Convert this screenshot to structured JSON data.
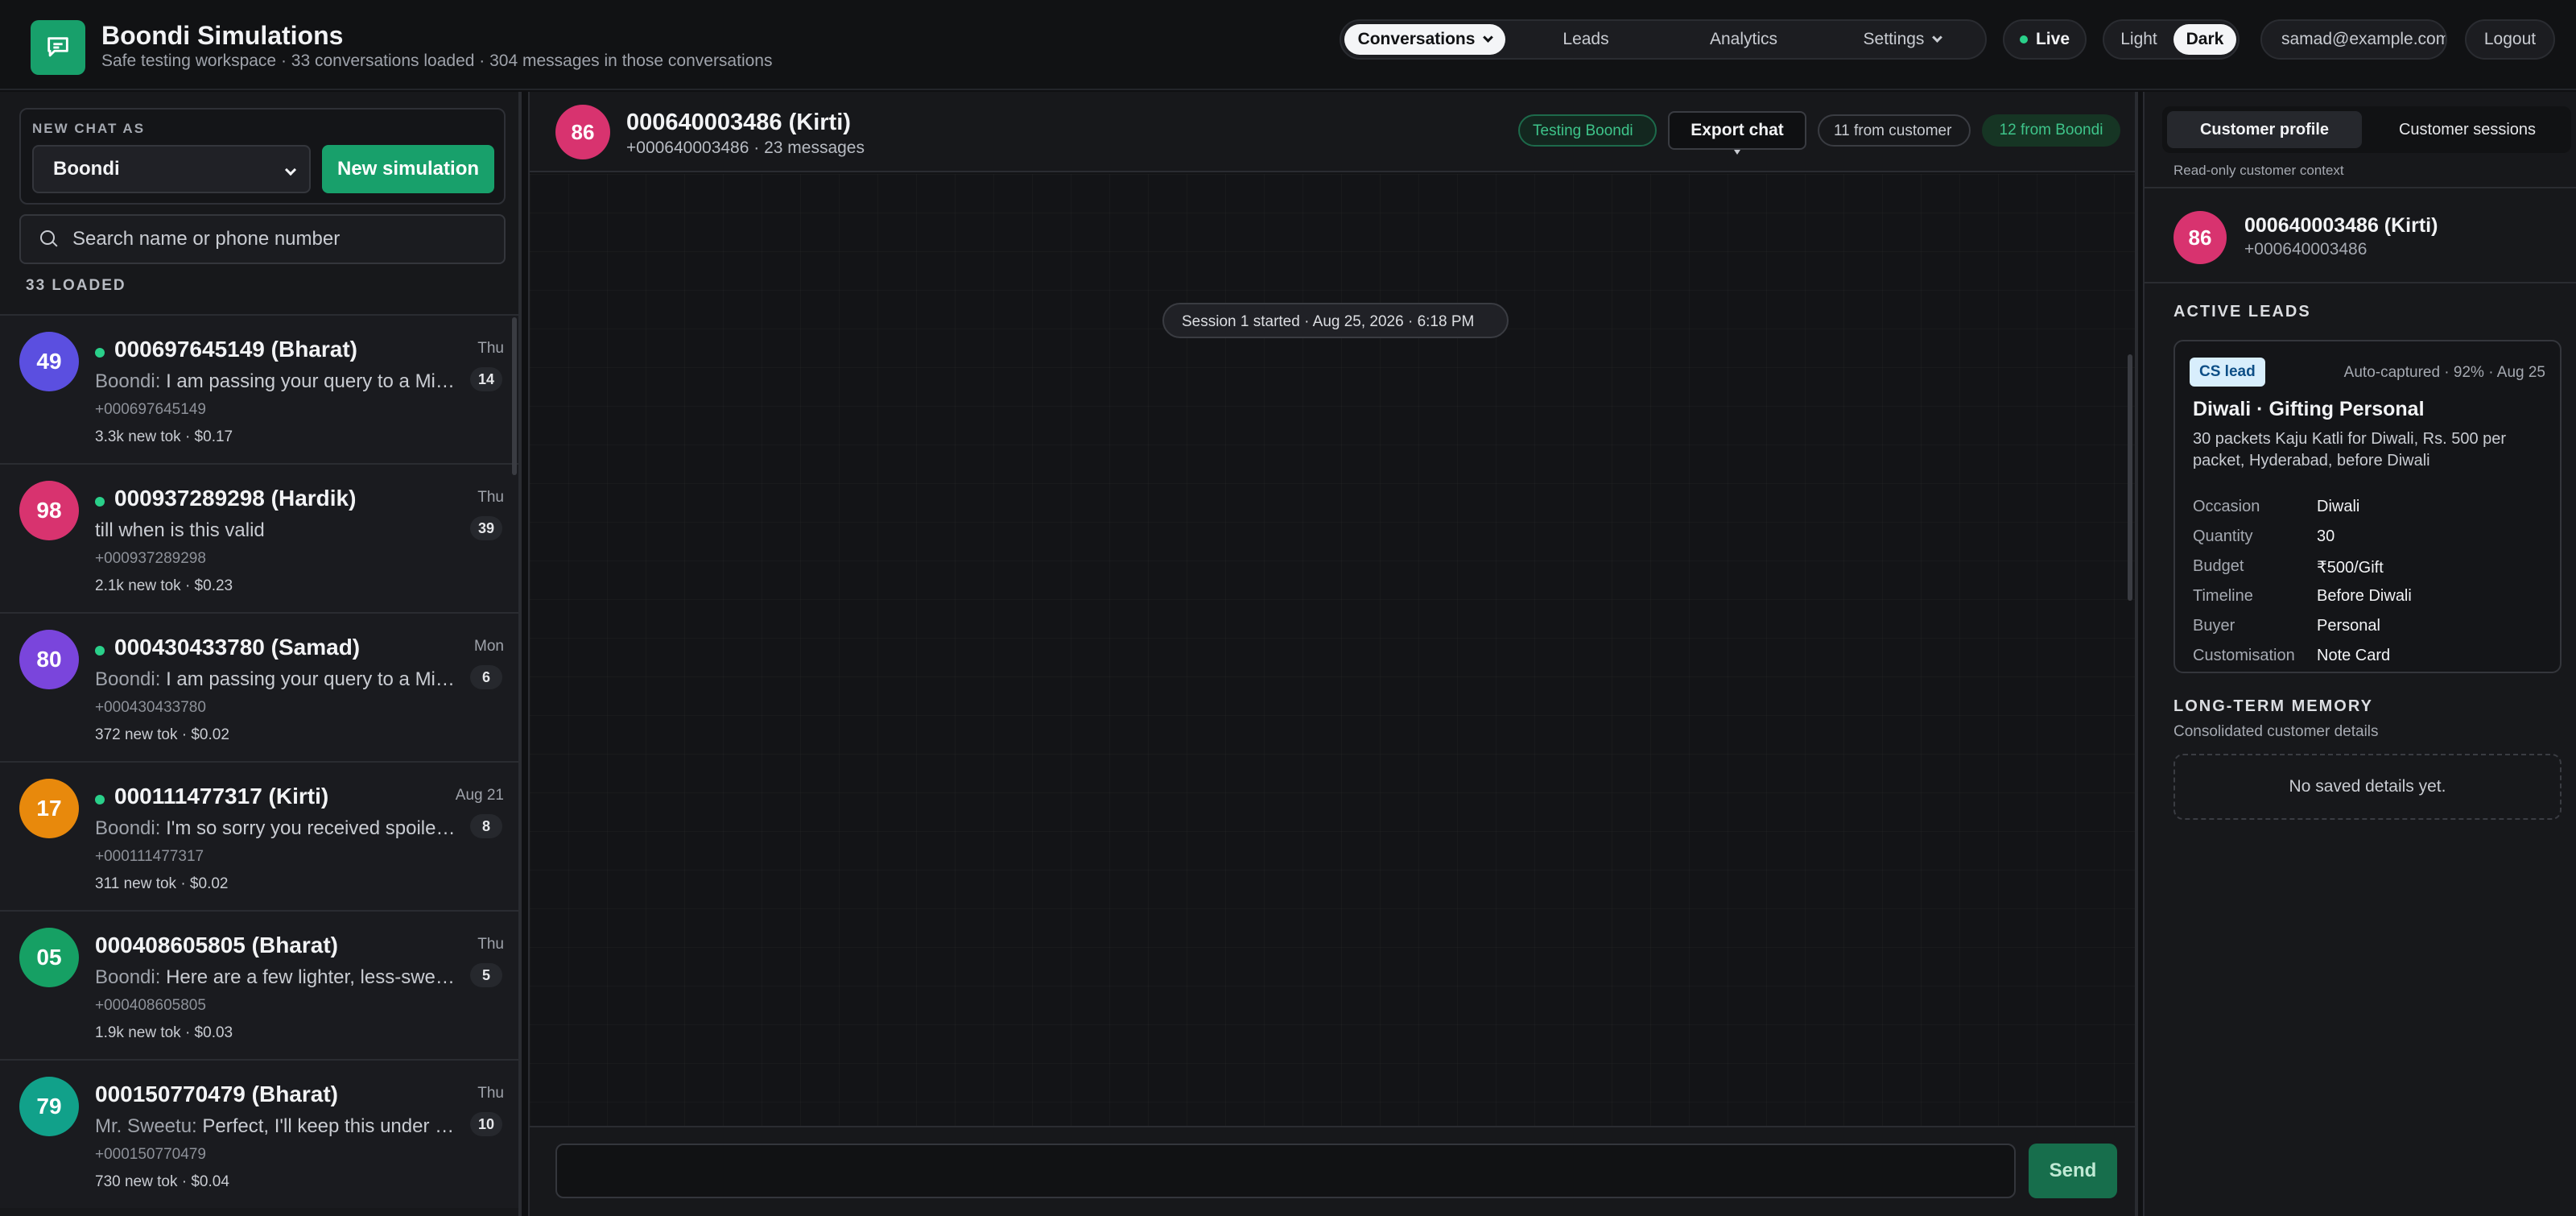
{
  "header": {
    "title": "Boondi Simulations",
    "subtitle": "Safe testing workspace · 33 conversations loaded · 304 messages in those conversations",
    "nav": [
      {
        "label": "Conversations",
        "active": true,
        "dropdown": true
      },
      {
        "label": "Leads",
        "active": false
      },
      {
        "label": "Analytics",
        "active": false
      },
      {
        "label": "Settings",
        "active": false,
        "dropdown": true
      }
    ],
    "live_label": "Live",
    "theme": {
      "light_label": "Light",
      "dark_label": "Dark",
      "selected": "Dark"
    },
    "user_email": "samad@example.com",
    "logout_label": "Logout"
  },
  "sidebar": {
    "new_chat_label": "NEW CHAT AS",
    "persona_value": "Boondi",
    "new_sim_label": "New simulation",
    "search_placeholder": "Search name or phone number",
    "loaded_label": "33 LOADED",
    "conversations": [
      {
        "initials": "49",
        "avatar_color": "#5b4fe0",
        "online": true,
        "name": "000697645149 (Bharat)",
        "date": "Thu",
        "count": "14",
        "prefix": "Boondi:",
        "preview": " I am passing your query to a Mithai expert on our team",
        "phone": "+000697645149",
        "meta": "3.3k new tok · $0.17"
      },
      {
        "initials": "98",
        "avatar_color": "#d8336f",
        "online": true,
        "name": "000937289298 (Hardik)",
        "date": "Thu",
        "count": "39",
        "prefix": "",
        "preview": "till when is this valid",
        "phone": "+000937289298",
        "meta": "2.1k new tok · $0.23"
      },
      {
        "initials": "80",
        "avatar_color": "#7a45dc",
        "online": true,
        "name": "000430433780 (Samad)",
        "date": "Mon",
        "count": "6",
        "prefix": "Boondi:",
        "preview": " I am passing your query to a Mithai expert on our team",
        "phone": "+000430433780",
        "meta": "372 new tok · $0.02"
      },
      {
        "initials": "17",
        "avatar_color": "#e8890c",
        "online": true,
        "name": "000111477317 (Kirti)",
        "date": "Aug 21",
        "count": "8",
        "prefix": "Boondi:",
        "preview": " I'm so sorry you received spoiled sweets",
        "phone": "+000111477317",
        "meta": "311 new tok · $0.02"
      },
      {
        "initials": "05",
        "avatar_color": "#16a064",
        "online": false,
        "name": "000408605805 (Bharat)",
        "date": "Thu",
        "count": "5",
        "prefix": "Boondi:",
        "preview": " Here are a few lighter, less-sweet options",
        "phone": "+000408605805",
        "meta": "1.9k new tok · $0.03"
      },
      {
        "initials": "79",
        "avatar_color": "#11a18a",
        "online": false,
        "name": "000150770479 (Bharat)",
        "date": "Thu",
        "count": "10",
        "prefix": "Mr. Sweetu:",
        "preview": " Perfect, I'll keep this under your budget",
        "phone": "+000150770479",
        "meta": "730 new tok · $0.04"
      }
    ]
  },
  "chat": {
    "avatar_initials": "86",
    "name": "000640003486 (Kirti)",
    "subtitle": "+000640003486 · 23 messages",
    "testing_label": "Testing Boondi",
    "export_label": "Export chat",
    "from_customer": "11 from customer",
    "from_boondi": "12 from Boondi",
    "session_label": "Session 1 started · Aug 25, 2026 · 6:18 PM",
    "composer_value": "",
    "send_label": "Send"
  },
  "profile": {
    "tabs": [
      "Customer profile",
      "Customer sessions"
    ],
    "readonly_note": "Read-only customer context",
    "avatar_initials": "86",
    "name": "000640003486 (Kirti)",
    "phone": "+000640003486",
    "active_leads_heading": "ACTIVE LEADS",
    "lead": {
      "badge": "CS lead",
      "auto": "Auto-captured · 92% · Aug 25",
      "title": "Diwali · Gifting Personal",
      "description": "30 packets Kaju Katli for Diwali, Rs. 500 per packet, Hyderabad, before Diwali",
      "fields": [
        {
          "k": "Occasion",
          "v": "Diwali"
        },
        {
          "k": "Quantity",
          "v": "30"
        },
        {
          "k": "Budget",
          "v": "₹500/Gift"
        },
        {
          "k": "Timeline",
          "v": "Before Diwali"
        },
        {
          "k": "Buyer",
          "v": "Personal"
        },
        {
          "k": "Customisation",
          "v": "Note Card"
        }
      ]
    },
    "memory_heading": "LONG-TERM MEMORY",
    "memory_sub": "Consolidated customer details",
    "memory_empty": "No saved details yet."
  },
  "colors": {
    "accent": "#18a06b",
    "online": "#2ad08a"
  }
}
